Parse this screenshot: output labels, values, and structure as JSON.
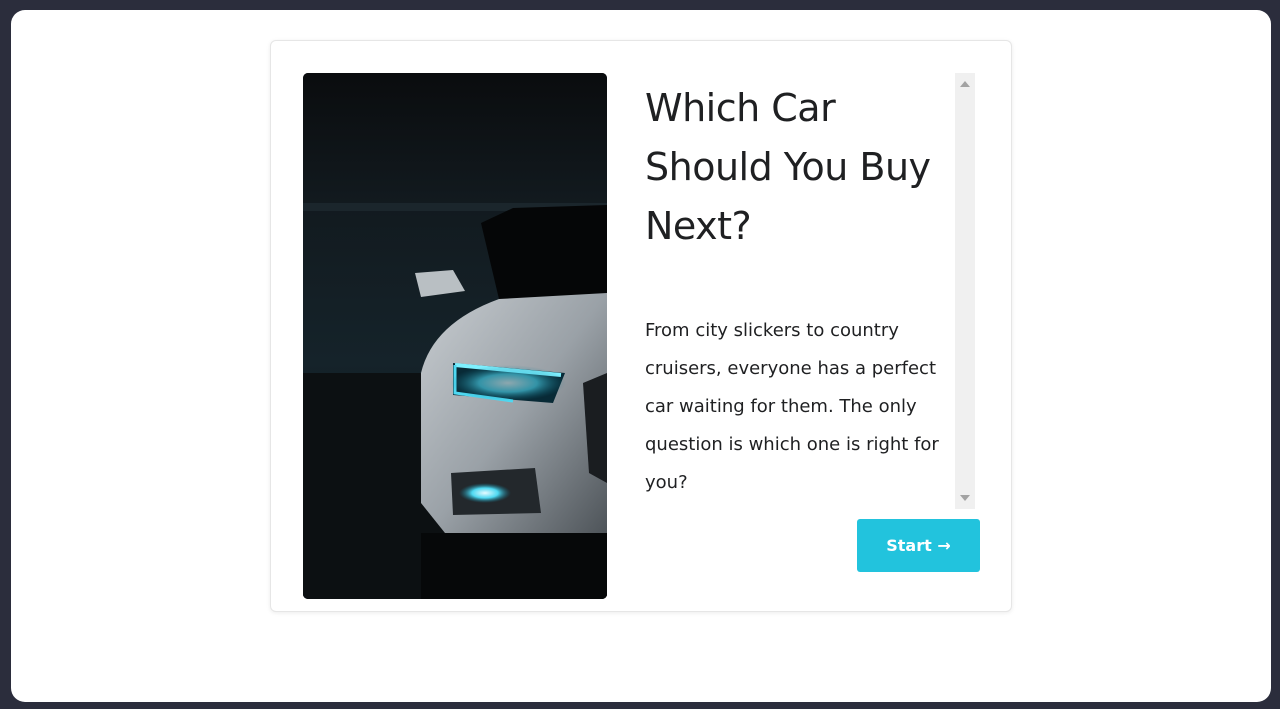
{
  "quiz": {
    "title": "Which Car Should You Buy Next?",
    "description": "From city slickers to country cruisers, everyone has a perfect car waiting for them. The only question is which one is right for you?",
    "start_label": "Start →"
  },
  "colors": {
    "accent": "#22c3dd",
    "background": "#2b2d3c",
    "text": "#1f2022"
  }
}
